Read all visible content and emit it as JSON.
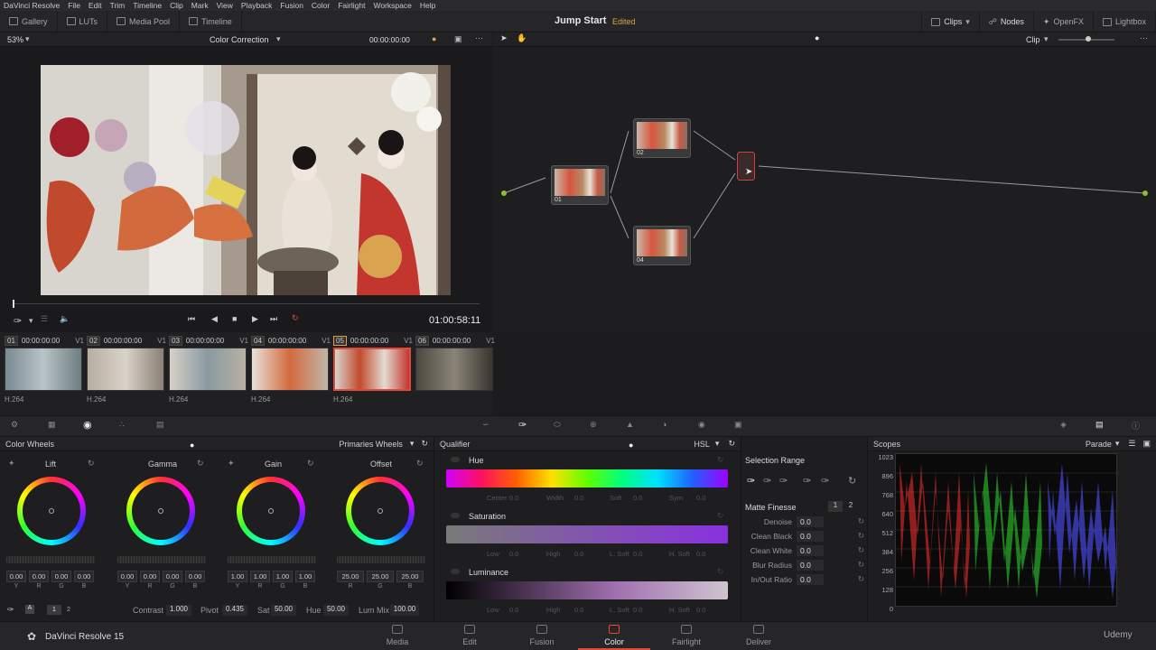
{
  "menu": [
    "DaVinci Resolve",
    "File",
    "Edit",
    "Trim",
    "Timeline",
    "Clip",
    "Mark",
    "View",
    "Playback",
    "Fusion",
    "Color",
    "Fairlight",
    "Workspace",
    "Help"
  ],
  "toolbar": {
    "gallery": "Gallery",
    "luts": "LUTs",
    "media_pool": "Media Pool",
    "timeline": "Timeline",
    "project": "Jump Start",
    "edited": "Edited",
    "clips": "Clips",
    "nodes": "Nodes",
    "openfx": "OpenFX",
    "lightbox": "Lightbox"
  },
  "viewer": {
    "zoom": "53%",
    "mode": "Color Correction",
    "timecode": "00:00:00:00",
    "playhead_tc": "01:00:58:11"
  },
  "nodes_header": {
    "scope": "Clip"
  },
  "nodes": [
    {
      "label": "01"
    },
    {
      "label": "02"
    },
    {
      "label": "04"
    }
  ],
  "clips": [
    {
      "num": "01",
      "tc": "00:00:00:00",
      "track": "V1",
      "codec": "H.264"
    },
    {
      "num": "02",
      "tc": "00:00:00:00",
      "track": "V1",
      "codec": "H.264"
    },
    {
      "num": "03",
      "tc": "00:00:00:00",
      "track": "V1",
      "codec": "H.264"
    },
    {
      "num": "04",
      "tc": "00:00:00:00",
      "track": "V1",
      "codec": "H.264"
    },
    {
      "num": "05",
      "tc": "00:00:00:00",
      "track": "V1",
      "codec": "H.264"
    },
    {
      "num": "06",
      "tc": "00:00:00:00",
      "track": "V1",
      "codec": ""
    }
  ],
  "color_wheels": {
    "title": "Color Wheels",
    "mode": "Primaries Wheels",
    "wheels": [
      {
        "name": "Lift",
        "values": [
          "0.00",
          "0.00",
          "0.00",
          "0.00"
        ],
        "channels": [
          "Y",
          "R",
          "G",
          "B"
        ]
      },
      {
        "name": "Gamma",
        "values": [
          "0.00",
          "0.00",
          "0.00",
          "0.00"
        ],
        "channels": [
          "Y",
          "R",
          "G",
          "B"
        ]
      },
      {
        "name": "Gain",
        "values": [
          "1.00",
          "1.00",
          "1.00",
          "1.00"
        ],
        "channels": [
          "Y",
          "R",
          "G",
          "B"
        ]
      },
      {
        "name": "Offset",
        "values": [
          "25.00",
          "25.00",
          "25.00"
        ],
        "channels": [
          "R",
          "G",
          "B"
        ]
      }
    ],
    "footer": {
      "contrast_label": "Contrast",
      "contrast": "1.000",
      "pivot_label": "Pivot",
      "pivot": "0.435",
      "sat_label": "Sat",
      "sat": "50.00",
      "hue_label": "Hue",
      "hue": "50.00",
      "lummix_label": "Lum Mix",
      "lummix": "100.00",
      "page1": "1",
      "page2": "2"
    }
  },
  "qualifier": {
    "title": "Qualifier",
    "mode": "HSL",
    "hue": {
      "label": "Hue",
      "sub": [
        "Center",
        "0.0",
        "Width",
        "0.0",
        "Soft",
        "0.0",
        "Sym",
        "0.0"
      ]
    },
    "saturation": {
      "label": "Saturation",
      "sub": [
        "Low",
        "0.0",
        "High",
        "0.0",
        "L. Soft",
        "0.0",
        "H. Soft",
        "0.0"
      ]
    },
    "luminance": {
      "label": "Luminance",
      "sub": [
        "Low",
        "0.0",
        "High",
        "0.0",
        "L. Soft",
        "0.0",
        "H. Soft",
        "0.0"
      ]
    }
  },
  "selection": {
    "title": "Selection Range",
    "matte_title": "Matte Finesse",
    "tab1": "1",
    "tab2": "2",
    "rows": [
      {
        "k": "Denoise",
        "v": "0.0"
      },
      {
        "k": "Clean Black",
        "v": "0.0"
      },
      {
        "k": "Clean White",
        "v": "0.0"
      },
      {
        "k": "Blur Radius",
        "v": "0.0"
      },
      {
        "k": "In/Out Ratio",
        "v": "0.0"
      }
    ]
  },
  "scopes": {
    "title": "Scopes",
    "mode": "Parade",
    "ticks": [
      "1023",
      "896",
      "768",
      "640",
      "512",
      "384",
      "256",
      "128",
      "0"
    ]
  },
  "bottom": {
    "app": "DaVinci Resolve 15",
    "pages": [
      "Media",
      "Edit",
      "Fusion",
      "Color",
      "Fairlight",
      "Deliver"
    ],
    "active": "Color",
    "watermark": "Udemy"
  }
}
